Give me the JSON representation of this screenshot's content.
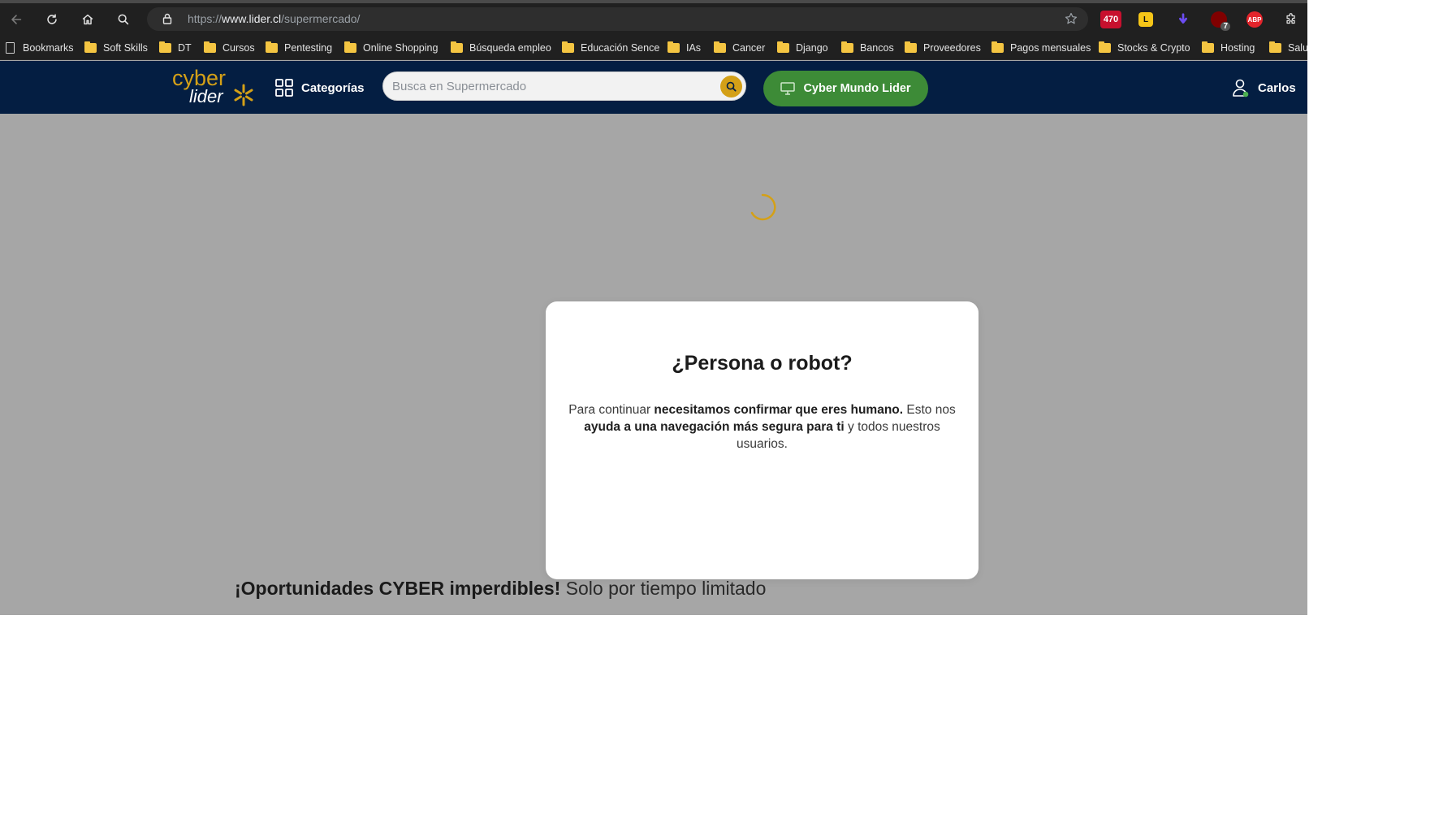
{
  "browser": {
    "url_scheme": "https://",
    "url_host": "www.lider.cl",
    "url_path": "/supermercado/",
    "extensions": [
      {
        "name": "sale-badge-extension",
        "label": "470",
        "color": "#c8102e"
      },
      {
        "name": "l-extension",
        "label": "L",
        "color": "#f5c518"
      },
      {
        "name": "download-extension",
        "label": "",
        "color": "#6c4df2"
      },
      {
        "name": "ublock-extension",
        "label": "7",
        "color": "#800000"
      },
      {
        "name": "adblock-plus-extension",
        "label": "ABP",
        "color": "#e3242b"
      }
    ]
  },
  "bookmarks": {
    "items": [
      {
        "label": "Bookmarks",
        "type": "page"
      },
      {
        "label": "Soft Skills",
        "type": "folder"
      },
      {
        "label": "DT",
        "type": "folder"
      },
      {
        "label": "Cursos",
        "type": "folder"
      },
      {
        "label": "Pentesting",
        "type": "folder"
      },
      {
        "label": "Online Shopping",
        "type": "folder"
      },
      {
        "label": "Búsqueda empleo",
        "type": "folder"
      },
      {
        "label": "Educación Sence",
        "type": "folder"
      },
      {
        "label": "IAs",
        "type": "folder"
      },
      {
        "label": "Cancer",
        "type": "folder"
      },
      {
        "label": "Django",
        "type": "folder"
      },
      {
        "label": "Bancos",
        "type": "folder"
      },
      {
        "label": "Proveedores",
        "type": "folder"
      },
      {
        "label": "Pagos mensuales",
        "type": "folder"
      },
      {
        "label": "Stocks & Crypto",
        "type": "folder"
      },
      {
        "label": "Hosting",
        "type": "folder"
      },
      {
        "label": "Salu",
        "type": "folder"
      }
    ]
  },
  "site_header": {
    "logo_top": "cyber",
    "logo_bottom": "lider",
    "categories_label": "Categorías",
    "search_placeholder": "Busca en Supermercado",
    "cyber_button_label": "Cyber Mundo Lider",
    "account_name": "Carlos",
    "colors": {
      "header_bg": "#041e42",
      "accent_yellow": "#d4a017",
      "cyber_green": "#3d8b37"
    }
  },
  "promo": {
    "strong": "¡Oportunidades CYBER imperdibles!",
    "light": "Solo por tiempo limitado"
  },
  "modal": {
    "title": "¿Persona o robot?",
    "body_1": "Para continuar ",
    "body_2": "necesitamos confirmar que eres humano.",
    "body_3": " Esto nos ",
    "body_4": "ayuda a una navegación más segura para ti",
    "body_5": " y todos nuestros usuarios."
  }
}
